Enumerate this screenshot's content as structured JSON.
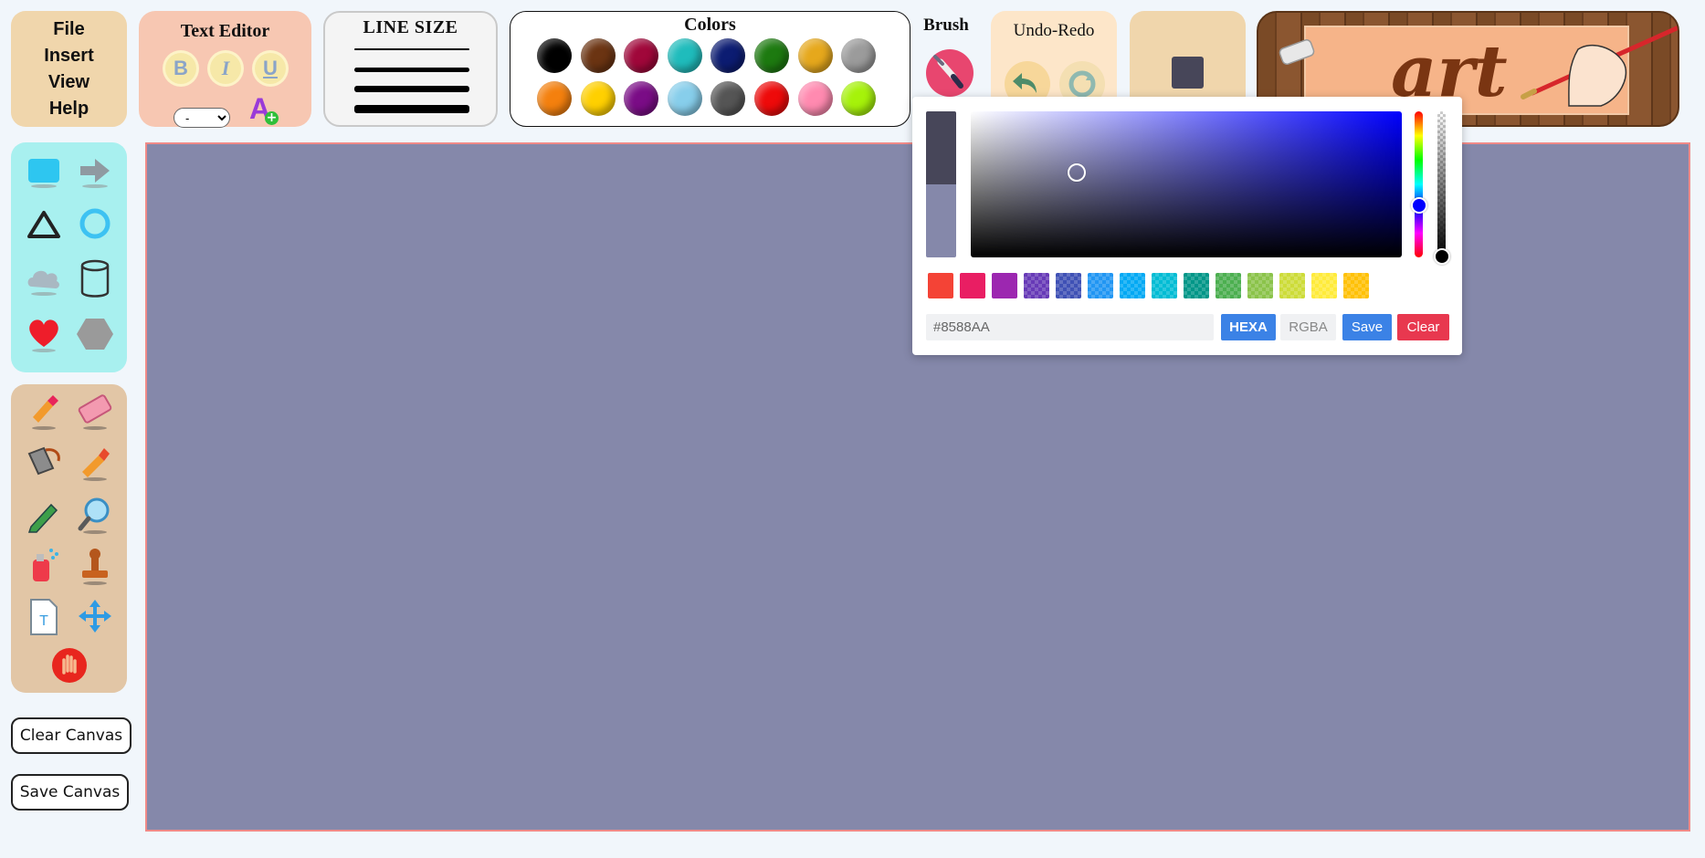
{
  "menu": {
    "items": [
      "File",
      "Insert",
      "View",
      "Help"
    ]
  },
  "text_editor": {
    "title": "Text Editor",
    "bold": "B",
    "italic": "I",
    "underline": "U",
    "size_value": "-",
    "font_color_glyph": "A"
  },
  "line_size": {
    "title": "LINE SIZE"
  },
  "colors": {
    "title": "Colors",
    "swatches": [
      "#000000",
      "#6b3412",
      "#a0073a",
      "#1fbcbc",
      "#0c1c72",
      "#1d7a10",
      "#e6a81c",
      "#9b9b9b",
      "#f4800e",
      "#ffd000",
      "#7a0c86",
      "#87ceeb",
      "#555555",
      "#ee0a0a",
      "#ff8ab0",
      "#a6f20a"
    ]
  },
  "brush": {
    "title": "Brush"
  },
  "undo_redo": {
    "title": "Undo-Redo"
  },
  "current_color": "#474659",
  "banner": {
    "word": "art"
  },
  "buttons": {
    "clear_canvas": "Clear Canvas",
    "save_canvas": "Save Canvas"
  },
  "canvas": {
    "background": "#8588aa",
    "border": "#f08a88"
  },
  "picker": {
    "prev_color": "#474659",
    "new_color": "#8588aa",
    "hex_value": "#8588AA",
    "hexa_label": "HEXA",
    "rgba_label": "RGBA",
    "save_label": "Save",
    "clear_label": "Clear",
    "swatches": [
      "#f44336",
      "#e91e63",
      "#9c27b0",
      "#673ab7",
      "#3f51b5",
      "#2196f3",
      "#03a9f4",
      "#00bcd4",
      "#009688",
      "#4caf50",
      "#8bc34a",
      "#cddc39",
      "#ffeb3b",
      "#ffc107"
    ]
  }
}
